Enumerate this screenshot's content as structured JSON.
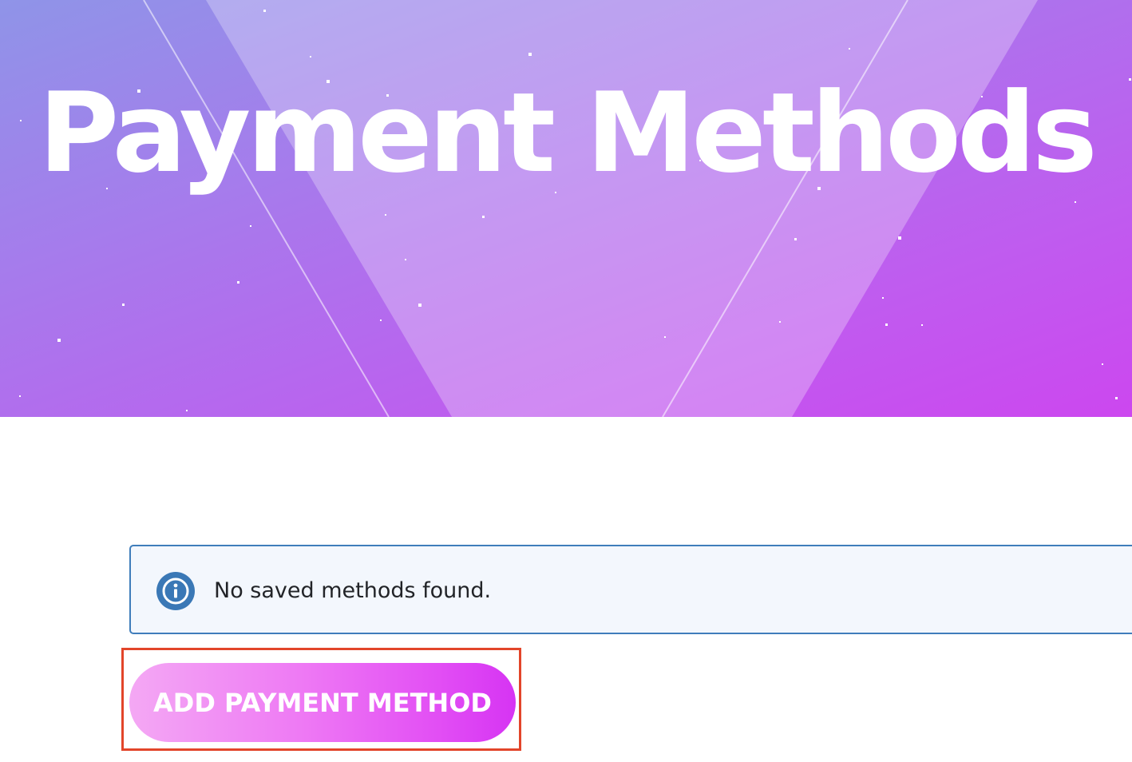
{
  "header": {
    "title": "Payment Methods"
  },
  "notice": {
    "icon": "info-icon",
    "message": "No saved methods found."
  },
  "actions": {
    "add_payment_method_label": "ADD PAYMENT METHOD"
  },
  "colors": {
    "hero_gradient_start": "#8f94e8",
    "hero_gradient_end": "#cc47ef",
    "notice_border": "#3f7dbb",
    "notice_background": "#f3f7fd",
    "info_icon": "#3a78b6",
    "button_gradient_start": "#f4a8f4",
    "button_gradient_end": "#d634f3",
    "highlight_border": "#e2452a"
  }
}
